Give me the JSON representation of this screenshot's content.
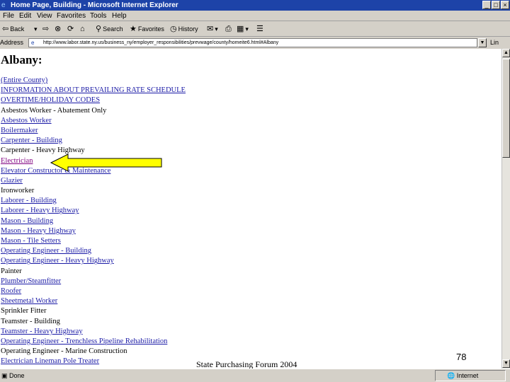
{
  "window": {
    "title": "Home Page, Building - Microsoft Internet Explorer",
    "min": "_",
    "max": "□",
    "close": "×"
  },
  "menu": [
    "File",
    "Edit",
    "View",
    "Favorites",
    "Tools",
    "Help"
  ],
  "toolbar": {
    "back": "Back",
    "search": "Search",
    "favorites": "Favorites",
    "history": "History"
  },
  "address": {
    "label": "Address",
    "url": "http://www.labor.state.ny.us/business_ny/employer_responsibilities/prevwage/county/homeite6.html#Albany",
    "links": "Lin"
  },
  "content": {
    "heading": "Albany:",
    "items": [
      {
        "text": "(Entire County)",
        "style": "lk"
      },
      {
        "text": "INFORMATION ABOUT PREVAILING RATE SCHEDULE",
        "style": "lk"
      },
      {
        "text": "OVERTIME/HOLIDAY CODES",
        "style": "lk"
      },
      {
        "text": "Asbestos Worker - Abatement Only",
        "style": "plain"
      },
      {
        "text": "Asbestos Worker",
        "style": "lk"
      },
      {
        "text": "Boilermaker",
        "style": "lk"
      },
      {
        "text": "Carpenter - Building",
        "style": "lk"
      },
      {
        "text": "Carpenter - Heavy Highway",
        "style": "plain"
      },
      {
        "text": "Electrician",
        "style": "visited"
      },
      {
        "text": "Elevator Constructor & Maintenance",
        "style": "lk"
      },
      {
        "text": "Glazier",
        "style": "lk"
      },
      {
        "text": "Ironworker",
        "style": "plain"
      },
      {
        "text": "Laborer - Building",
        "style": "lk"
      },
      {
        "text": "Laborer - Heavy Highway",
        "style": "lk"
      },
      {
        "text": "Mason - Building",
        "style": "lk"
      },
      {
        "text": "Mason - Heavy Highway",
        "style": "lk"
      },
      {
        "text": "Mason - Tile Setters",
        "style": "lk"
      },
      {
        "text": "Operating Engineer - Building",
        "style": "lk"
      },
      {
        "text": "Operating Engineer - Heavy Highway",
        "style": "lk"
      },
      {
        "text": "Painter",
        "style": "plain"
      },
      {
        "text": "Plumber/Steamfitter",
        "style": "lk"
      },
      {
        "text": "Roofer",
        "style": "lk"
      },
      {
        "text": "Sheetmetal Worker",
        "style": "lk"
      },
      {
        "text": "Sprinkler Fitter",
        "style": "plain"
      },
      {
        "text": "Teamster - Building",
        "style": "plain"
      },
      {
        "text": "Teamster - Heavy Highway",
        "style": "lk"
      },
      {
        "text": "Operating Engineer - Trenchless Pipeline Rehabilitation",
        "style": "lk"
      },
      {
        "text": "Operating Engineer - Marine Construction",
        "style": "plain"
      },
      {
        "text": "Electrician Lineman Pole Treater",
        "style": "lk"
      }
    ]
  },
  "status": {
    "left": "Done",
    "zone": "Internet"
  },
  "slide": {
    "footer": "State Purchasing Forum 2004",
    "page_number": "78"
  },
  "colors": {
    "arrow_fill": "#ffff00",
    "link": "#1a1aa6",
    "visited": "#800080",
    "titlebar": "#1d43a8"
  }
}
